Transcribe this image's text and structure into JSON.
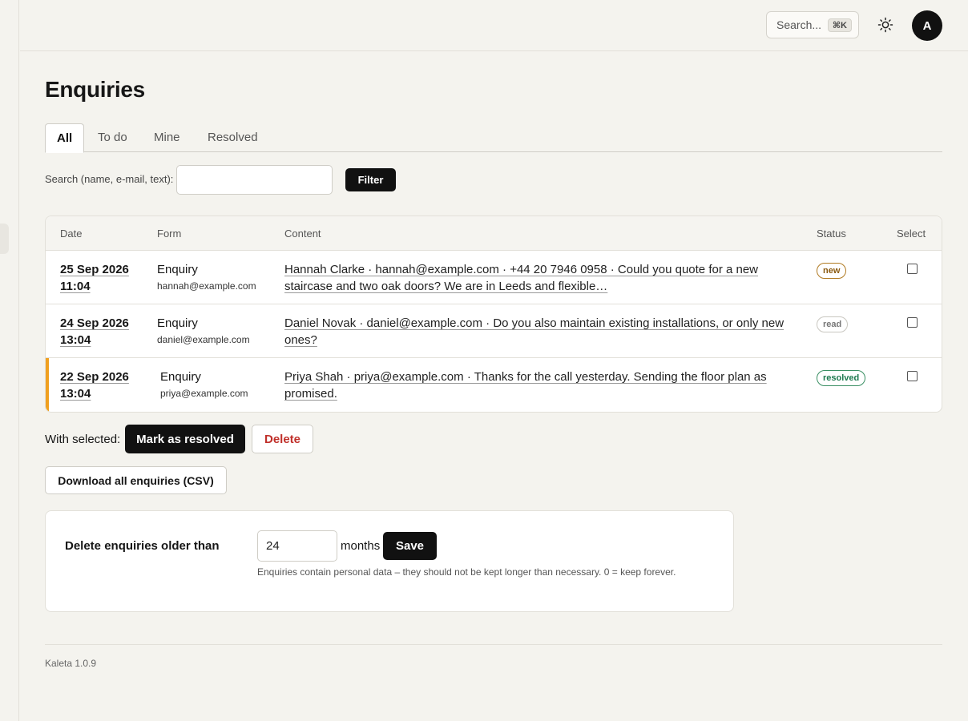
{
  "header": {
    "search_placeholder": "Search...",
    "search_shortcut": "⌘K",
    "theme_icon": "sun-icon",
    "avatar_initial": "A"
  },
  "page": {
    "title": "Enquiries"
  },
  "tabs": [
    {
      "label": "All",
      "active": true
    },
    {
      "label": "To do",
      "active": false
    },
    {
      "label": "Mine",
      "active": false
    },
    {
      "label": "Resolved",
      "active": false
    }
  ],
  "filter": {
    "label": "Search (name, e-mail, text):",
    "value": "",
    "button_label": "Filter"
  },
  "table": {
    "columns": [
      "Date",
      "Form",
      "Content",
      "Status",
      "Select"
    ],
    "rows": [
      {
        "date": "25 Sep 2026 11:04",
        "form": "Enquiry",
        "email": "hannah@example.com",
        "content": "Hannah Clarke · hannah@example.com · +44 20 7946 0958 · Could you quote for a new staircase and two oak doors? We are in Leeds and flexible…",
        "status": "new",
        "selected": false
      },
      {
        "date": "24 Sep 2026 13:04",
        "form": "Enquiry",
        "email": "daniel@example.com",
        "content": "Daniel Novak · daniel@example.com · Do you also maintain existing installations, or only new ones?",
        "status": "read",
        "selected": false
      },
      {
        "date": "22 Sep 2026 13:04",
        "form": "Enquiry",
        "email": "priya@example.com",
        "content": "Priya Shah · priya@example.com · Thanks for the call yesterday. Sending the floor plan as promised.",
        "status": "resolved",
        "selected": false
      }
    ]
  },
  "bulk": {
    "label": "With selected:",
    "resolve_label": "Mark as resolved",
    "delete_label": "Delete"
  },
  "export": {
    "csv_label": "Download all enquiries (CSV)"
  },
  "retention": {
    "label": "Delete enquiries older than",
    "value": "24",
    "unit": "months",
    "save_label": "Save",
    "note": "Enquiries contain personal data – they should not be kept longer than necessary. 0 = keep forever."
  },
  "footer": {
    "version": "Kaleta 1.0.9"
  },
  "colors": {
    "accent_row": "#f0a020",
    "status_new": "#8a5a10",
    "status_read": "#777777",
    "status_resolved": "#1e7a4f",
    "danger": "#c0302a"
  }
}
